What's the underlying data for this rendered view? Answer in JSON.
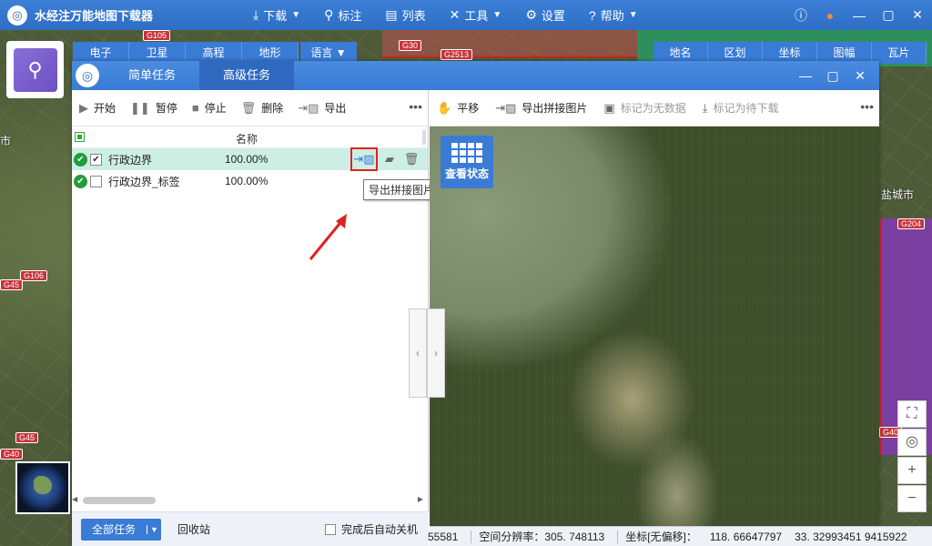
{
  "app": {
    "title": "水经注万能地图下载器"
  },
  "menu": [
    {
      "icon": "download-icon",
      "glyph": "⤓",
      "label": "下载",
      "caret": true
    },
    {
      "icon": "marker-icon",
      "glyph": "⚲",
      "label": "标注",
      "caret": false
    },
    {
      "icon": "list-icon",
      "glyph": "▤",
      "label": "列表",
      "caret": false
    },
    {
      "icon": "tools-icon",
      "glyph": "✕",
      "label": "工具",
      "caret": true
    },
    {
      "icon": "settings-icon",
      "glyph": "⚙",
      "label": "设置",
      "caret": false
    },
    {
      "icon": "help-icon",
      "glyph": "?",
      "label": "帮助",
      "caret": true
    }
  ],
  "map_tabs": [
    "电子",
    "卫星",
    "高程",
    "地形"
  ],
  "lang_tab": "语言",
  "right_tabs": [
    "地名",
    "区划",
    "坐标",
    "图幅",
    "瓦片"
  ],
  "map_labels": {
    "roads": [
      "G105",
      "G30",
      "G2513",
      "G106",
      "G45",
      "G40",
      "G204",
      "G45",
      "G40"
    ],
    "cities": [
      "市",
      "盐城市"
    ]
  },
  "dialog": {
    "tabs": [
      "简单任务",
      "高级任务"
    ],
    "active_tab": 1
  },
  "left_toolbar": {
    "start": "开始",
    "pause": "暂停",
    "stop": "停止",
    "delete": "删除",
    "export": "导出"
  },
  "task_list": {
    "header_name": "名称",
    "rows": [
      {
        "name": "行政边界",
        "progress": "100.00%",
        "checked": true,
        "selected": true
      },
      {
        "name": "行政边界_标签",
        "progress": "100.00%",
        "checked": false,
        "selected": false
      }
    ]
  },
  "tooltip": "导出拼接图片",
  "bottom_bar": {
    "all_tasks": "全部任务",
    "recycle": "回收站",
    "auto_shutdown": "完成后自动关机"
  },
  "right_toolbar": {
    "pan": "平移",
    "export_mosaic": "导出拼接图片",
    "mark_no_data": "标记为无数据",
    "mark_pending": "标记为待下载"
  },
  "view_status": "查看状态",
  "statusbar": {
    "scale": "55581",
    "resolution": "空间分辨率：305. 748113",
    "coord_label": "坐标[无偏移]：",
    "lon": "118. 66647797",
    "lat": "33. 32993451 9415922"
  },
  "colors": {
    "accent": "#3a7bd5",
    "highlight": "#e02020",
    "ok": "#1f9d3a"
  }
}
